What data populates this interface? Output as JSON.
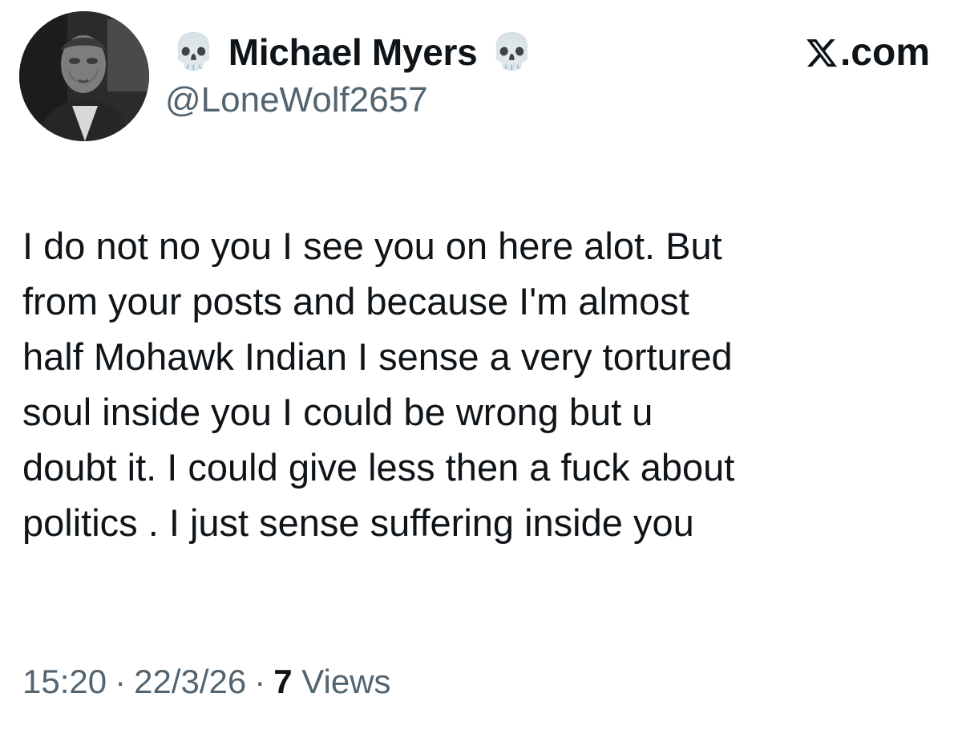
{
  "author": {
    "name_prefix_emoji": "💀",
    "display_name": "Michael Myers",
    "name_suffix_emoji": "💀",
    "handle": "@LoneWolf2657"
  },
  "brand": {
    "label": ".com",
    "icon": "x-logo-icon"
  },
  "post": {
    "lines": [
      "I do not no you I see you on here alot. But",
      "from your posts and because I'm almost",
      "half Mohawk Indian I sense a very tortured",
      "soul inside you I could be wrong but u",
      "doubt it. I could give less then a fuck about",
      "politics . I just sense suffering inside you"
    ]
  },
  "meta": {
    "time": "15:20",
    "separator": "·",
    "date": "22/3/26",
    "views_count": "7",
    "views_label": "Views"
  },
  "colors": {
    "text": "#0f1419",
    "secondary": "#536471",
    "background": "#ffffff"
  }
}
